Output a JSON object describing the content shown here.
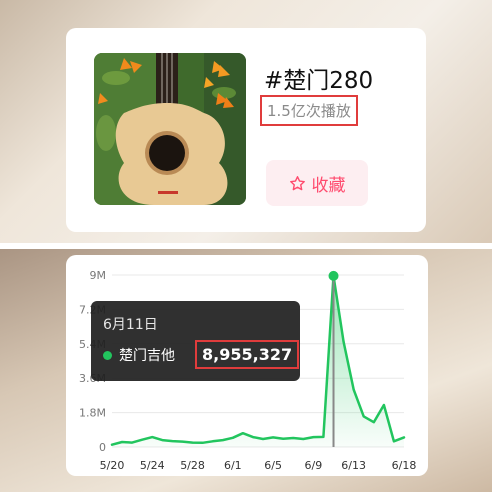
{
  "song_card": {
    "hashtag": "#楚门280",
    "plays": "1.5亿次播放",
    "favorite_label": "收藏",
    "favorite_icon": "star-outline-icon",
    "accent_color": "#ff4b6e"
  },
  "tooltip": {
    "date": "6月11日",
    "series_name": "楚门吉他",
    "value": "8,955,327"
  },
  "chart_data": {
    "type": "area",
    "x": [
      "5/20",
      "5/21",
      "5/22",
      "5/23",
      "5/24",
      "5/25",
      "5/26",
      "5/27",
      "5/28",
      "5/29",
      "5/30",
      "5/31",
      "6/1",
      "6/2",
      "6/3",
      "6/4",
      "6/5",
      "6/6",
      "6/7",
      "6/8",
      "6/9",
      "6/10",
      "6/11",
      "6/12",
      "6/13",
      "6/14",
      "6/15",
      "6/16",
      "6/17",
      "6/18"
    ],
    "series": [
      {
        "name": "楚门吉他",
        "color": "#22c55e",
        "values": [
          120000,
          260000,
          230000,
          380000,
          520000,
          360000,
          310000,
          280000,
          230000,
          220000,
          300000,
          360000,
          480000,
          720000,
          520000,
          420000,
          500000,
          430000,
          470000,
          420000,
          520000,
          530000,
          8955327,
          5500000,
          3000000,
          1600000,
          1300000,
          2200000,
          300000,
          500000
        ]
      }
    ],
    "y_ticks": [
      "0",
      "1.8M",
      "3.6M",
      "5.4M",
      "7.2M",
      "9M"
    ],
    "x_ticks": [
      "5/20",
      "5/24",
      "5/28",
      "6/1",
      "6/5",
      "6/9",
      "6/13",
      "6/18"
    ],
    "ylim": [
      0,
      9000000
    ],
    "highlight": "6/11",
    "grid": true
  }
}
